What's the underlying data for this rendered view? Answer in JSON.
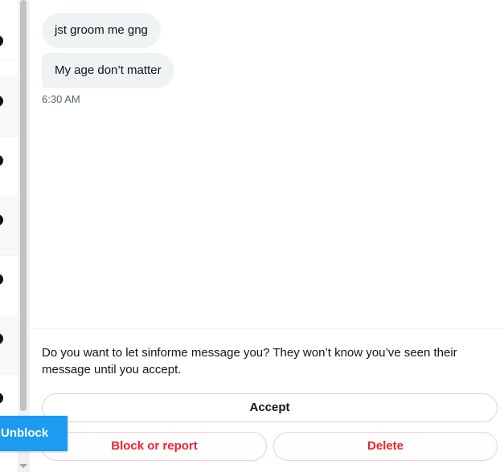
{
  "messages": [
    {
      "text": "jst groom me gng"
    },
    {
      "text": "My age don’t matter"
    }
  ],
  "timestamp": "6:30 AM",
  "request": {
    "prompt": "Do you want to let sinforme message you? They won’t know you’ve seen their message until you accept.",
    "accept_label": "Accept",
    "block_label": "Block or report",
    "delete_label": "Delete"
  },
  "unblock_label": "Unblock",
  "colors": {
    "accent": "#1d9bf0",
    "danger": "#f4212e",
    "bubble": "#eff3f4",
    "muted": "#536471"
  }
}
